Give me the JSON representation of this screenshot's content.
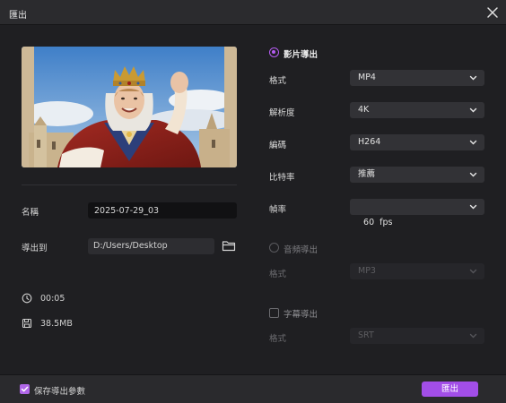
{
  "window": {
    "title": "匯出"
  },
  "left": {
    "name_label": "名稱",
    "name_value": "2025-07-29_03",
    "path_label": "導出到",
    "path_value": "D:/Users/Desktop",
    "duration": "00:05",
    "size": "38.5MB"
  },
  "video": {
    "title": "影片導出",
    "fields": [
      {
        "label": "格式",
        "value": "MP4"
      },
      {
        "label": "解析度",
        "value": "4K"
      },
      {
        "label": "編碼",
        "value": "H264"
      },
      {
        "label": "比特率",
        "value": "推薦"
      },
      {
        "label": "幀率",
        "value": "60  fps"
      }
    ]
  },
  "audio": {
    "title": "音頻導出",
    "format_label": "格式",
    "format_value": "MP3"
  },
  "subtitle": {
    "title": "字幕導出",
    "format_label": "格式",
    "format_value": "SRT"
  },
  "footer": {
    "save_params_label": "保存導出參數",
    "export_button": "匯出"
  },
  "colors": {
    "accent": "#a24ee8",
    "background": "#1f1f22"
  }
}
